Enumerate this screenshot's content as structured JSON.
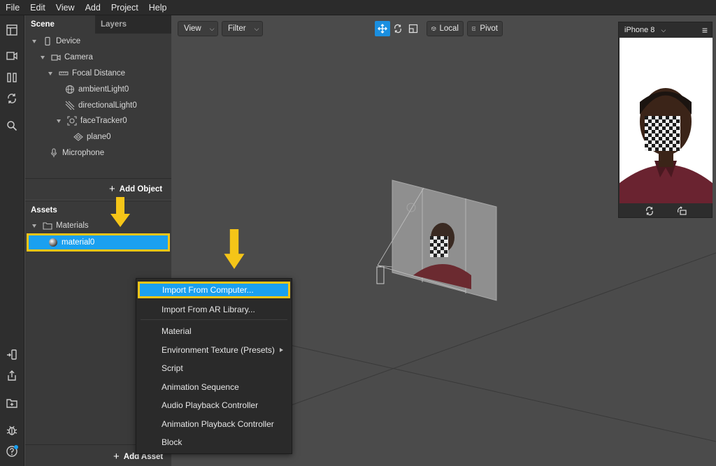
{
  "menubar": {
    "items": [
      "File",
      "Edit",
      "View",
      "Add",
      "Project",
      "Help"
    ]
  },
  "scene_panel": {
    "tabs": [
      "Scene",
      "Layers"
    ],
    "tree": [
      {
        "label": "Device",
        "icon": "device-icon"
      },
      {
        "label": "Camera",
        "icon": "camera-icon"
      },
      {
        "label": "Focal Distance",
        "icon": "focal-distance-icon"
      },
      {
        "label": "ambientLight0",
        "icon": "ambient-light-icon"
      },
      {
        "label": "directionalLight0",
        "icon": "directional-light-icon"
      },
      {
        "label": "faceTracker0",
        "icon": "face-tracker-icon"
      },
      {
        "label": "plane0",
        "icon": "plane-icon"
      },
      {
        "label": "Microphone",
        "icon": "microphone-icon"
      }
    ],
    "add_object_label": "Add Object"
  },
  "assets_panel": {
    "title": "Assets",
    "folder_label": "Materials",
    "selected_item": "material0",
    "add_asset_label": "Add Asset"
  },
  "viewport": {
    "view_button": "View",
    "filter_button": "Filter",
    "local_button": "Local",
    "pivot_button": "Pivot"
  },
  "preview": {
    "device_label": "iPhone 8"
  },
  "context_menu": {
    "items": [
      "Import From Computer...",
      "Import From AR Library...",
      "Material",
      "Environment Texture (Presets)",
      "Script",
      "Animation Sequence",
      "Audio Playback Controller",
      "Animation Playback Controller",
      "Block"
    ]
  },
  "colors": {
    "accent": "#1aa0f0",
    "highlight_border": "#f5c518",
    "arrow": "#f5c518"
  }
}
